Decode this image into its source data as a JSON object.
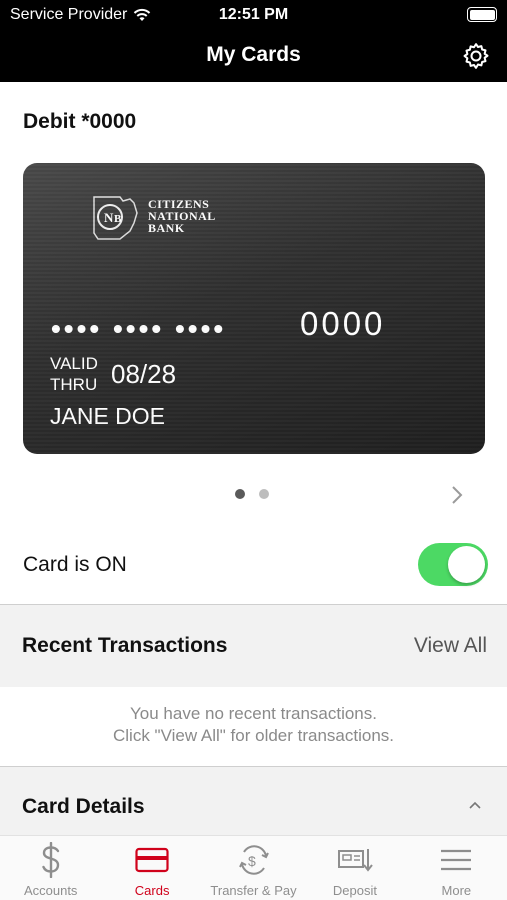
{
  "status": {
    "carrier": "Service Provider",
    "time": "12:51 PM"
  },
  "nav": {
    "title": "My Cards"
  },
  "card": {
    "title": "Debit *0000",
    "bank_name": [
      "CITIZENS",
      "NATIONAL",
      "BANK"
    ],
    "masked_groups": "•••• •••• ••••",
    "last4": "0000",
    "valid_label_1": "VALID",
    "valid_label_2": "THRU",
    "expiry": "08/28",
    "holder": "JANE DOE"
  },
  "pager": {
    "total": 2,
    "current": 1
  },
  "card_status": {
    "label": "Card is ON",
    "on": true,
    "accent": "#4cd964"
  },
  "recent": {
    "title": "Recent Transactions",
    "view_all": "View All",
    "empty_line_1": "You have no recent transactions.",
    "empty_line_2": "Click \"View All\" for older transactions."
  },
  "details": {
    "title": "Card Details"
  },
  "tabs": [
    {
      "label": "Accounts",
      "icon": "dollar-icon"
    },
    {
      "label": "Cards",
      "icon": "card-icon",
      "active": true
    },
    {
      "label": "Transfer & Pay",
      "icon": "transfer-icon"
    },
    {
      "label": "Deposit",
      "icon": "deposit-icon"
    },
    {
      "label": "More",
      "icon": "menu-icon"
    }
  ],
  "colors": {
    "active_tab": "#d0021b",
    "inactive_tab": "#8e8e8e"
  }
}
